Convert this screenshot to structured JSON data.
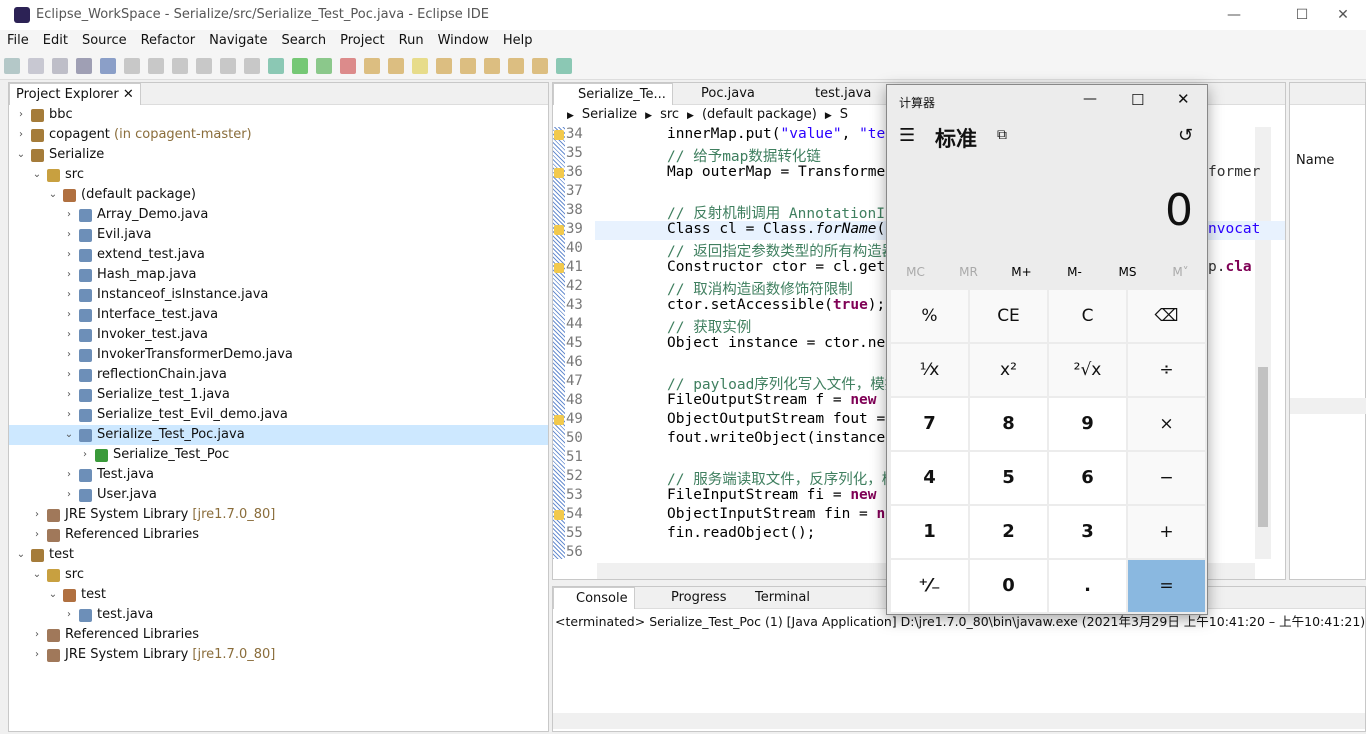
{
  "window": {
    "title": "Eclipse_WorkSpace - Serialize/src/Serialize_Test_Poc.java - Eclipse IDE",
    "minimize": "—",
    "maximize": "☐",
    "close": "✕"
  },
  "menu": [
    "File",
    "Edit",
    "Source",
    "Refactor",
    "Navigate",
    "Search",
    "Project",
    "Run",
    "Window",
    "Help"
  ],
  "explorer": {
    "title": "Project Explorer",
    "items": [
      {
        "level": 0,
        "arrow": "›",
        "label": "bbc",
        "icon": "project"
      },
      {
        "level": 0,
        "arrow": "›",
        "label": "copagent",
        "suffix": " (in copagent-master)",
        "icon": "project"
      },
      {
        "level": 0,
        "arrow": "⌄",
        "label": "Serialize",
        "icon": "project"
      },
      {
        "level": 1,
        "arrow": "⌄",
        "label": "src",
        "icon": "source-folder"
      },
      {
        "level": 2,
        "arrow": "⌄",
        "label": "(default package)",
        "icon": "package"
      },
      {
        "level": 3,
        "arrow": "›",
        "label": "Array_Demo.java",
        "icon": "java-file"
      },
      {
        "level": 3,
        "arrow": "›",
        "label": "Evil.java",
        "icon": "java-file"
      },
      {
        "level": 3,
        "arrow": "›",
        "label": "extend_test.java",
        "icon": "java-file"
      },
      {
        "level": 3,
        "arrow": "›",
        "label": "Hash_map.java",
        "icon": "java-file"
      },
      {
        "level": 3,
        "arrow": "›",
        "label": "Instanceof_isInstance.java",
        "icon": "java-file"
      },
      {
        "level": 3,
        "arrow": "›",
        "label": "Interface_test.java",
        "icon": "java-file"
      },
      {
        "level": 3,
        "arrow": "›",
        "label": "Invoker_test.java",
        "icon": "java-file"
      },
      {
        "level": 3,
        "arrow": "›",
        "label": "InvokerTransformerDemo.java",
        "icon": "java-file"
      },
      {
        "level": 3,
        "arrow": "›",
        "label": "reflectionChain.java",
        "icon": "java-file"
      },
      {
        "level": 3,
        "arrow": "›",
        "label": "Serialize_test_1.java",
        "icon": "java-file"
      },
      {
        "level": 3,
        "arrow": "›",
        "label": "Serialize_test_Evil_demo.java",
        "icon": "java-file"
      },
      {
        "level": 3,
        "arrow": "⌄",
        "label": "Serialize_Test_Poc.java",
        "icon": "java-file",
        "selected": true
      },
      {
        "level": 4,
        "arrow": "›",
        "label": "Serialize_Test_Poc",
        "icon": "class-runnable"
      },
      {
        "level": 3,
        "arrow": "›",
        "label": "Test.java",
        "icon": "java-file"
      },
      {
        "level": 3,
        "arrow": "›",
        "label": "User.java",
        "icon": "java-file"
      },
      {
        "level": 1,
        "arrow": "›",
        "label": "JRE System Library",
        "suffix": " [jre1.7.0_80]",
        "icon": "library"
      },
      {
        "level": 1,
        "arrow": "›",
        "label": "Referenced Libraries",
        "icon": "library"
      },
      {
        "level": 0,
        "arrow": "⌄",
        "label": "test",
        "icon": "project"
      },
      {
        "level": 1,
        "arrow": "⌄",
        "label": "src",
        "icon": "source-folder"
      },
      {
        "level": 2,
        "arrow": "⌄",
        "label": "test",
        "icon": "package"
      },
      {
        "level": 3,
        "arrow": "›",
        "label": "test.java",
        "icon": "java-file"
      },
      {
        "level": 1,
        "arrow": "›",
        "label": "Referenced Libraries",
        "icon": "library"
      },
      {
        "level": 1,
        "arrow": "›",
        "label": "JRE System Library",
        "suffix": " [jre1.7.0_80]",
        "icon": "library"
      }
    ]
  },
  "editor": {
    "tabs": [
      "Serialize_Te...",
      "Poc.java",
      "test.java"
    ],
    "breadcrumb": [
      "Serialize",
      "src",
      "(default package)",
      "S"
    ],
    "lines": [
      {
        "n": "34",
        "warn": true,
        "html": "innerMap.put(<span class='str'>\"value\"</span>, <span class='str'>\"te</span>"
      },
      {
        "n": "35",
        "html": "<span class='cm'>// 给予map数据转化链</span>"
      },
      {
        "n": "36",
        "warn": true,
        "html": "Map outerMap = Transforme",
        "right": "former"
      },
      {
        "n": "37",
        "html": ""
      },
      {
        "n": "38",
        "html": "<span class='cm'>// 反射机制调用 AnnotationInv</span>"
      },
      {
        "n": "39",
        "warn": true,
        "current": true,
        "html": "Class cl = Class.<i>forName</i>(",
        "right": "nvocat"
      },
      {
        "n": "40",
        "html": "<span class='cm'>// 返回指定参数类型的所有构造器，包</span>"
      },
      {
        "n": "41",
        "warn": true,
        "html": "Constructor ctor = cl.get",
        "right": "p.<b class='kw'>cla</b>"
      },
      {
        "n": "42",
        "html": "<span class='cm'>// 取消构造函数修饰符限制</span>"
      },
      {
        "n": "43",
        "html": "ctor.setAccessible(<span class='kw'>true</span>);"
      },
      {
        "n": "44",
        "html": "<span class='cm'>// 获取实例</span>"
      },
      {
        "n": "45",
        "html": "Object instance = ctor.ne"
      },
      {
        "n": "46",
        "html": ""
      },
      {
        "n": "47",
        "html": "<span class='cm'>// payload序列化写入文件，模拟网</span>"
      },
      {
        "n": "48",
        "html": "FileOutputStream f = <span class='kw'>new</span>"
      },
      {
        "n": "49",
        "warn": true,
        "html": "ObjectOutputStream fout ="
      },
      {
        "n": "50",
        "html": "fout.writeObject(instance"
      },
      {
        "n": "51",
        "html": ""
      },
      {
        "n": "52",
        "html": "<span class='cm'>// 服务端读取文件，反序列化，模拟网</span>"
      },
      {
        "n": "53",
        "html": "FileInputStream fi = <span class='kw'>new</span>"
      },
      {
        "n": "54",
        "warn": true,
        "html": "ObjectInputStream fin = <span class='kw'>n</span>"
      },
      {
        "n": "55",
        "html": "fin.readObject();"
      },
      {
        "n": "56",
        "html": ""
      }
    ]
  },
  "outline": {
    "header": "Name"
  },
  "console": {
    "tabs": [
      "Console",
      "Progress",
      "Terminal"
    ],
    "status": "<terminated> Serialize_Test_Poc (1) [Java Application] D:\\jre1.7.0_80\\bin\\javaw.exe  (2021年3月29日 上午10:41:20 – 上午10:41:21)"
  },
  "calculator": {
    "title": "计算器",
    "mode": "标准",
    "display": "0",
    "memory": [
      "MC",
      "MR",
      "M+",
      "M-",
      "MS",
      "M˅"
    ],
    "memory_enabled": [
      false,
      false,
      true,
      true,
      true,
      false
    ],
    "buttons": [
      "%",
      "CE",
      "C",
      "⌫",
      "¹⁄x",
      "x²",
      "²√x",
      "÷",
      "7",
      "8",
      "9",
      "×",
      "4",
      "5",
      "6",
      "−",
      "1",
      "2",
      "3",
      "+",
      "⁺⁄₋",
      "0",
      ".",
      "="
    ],
    "accent": "#8ab8e0"
  }
}
